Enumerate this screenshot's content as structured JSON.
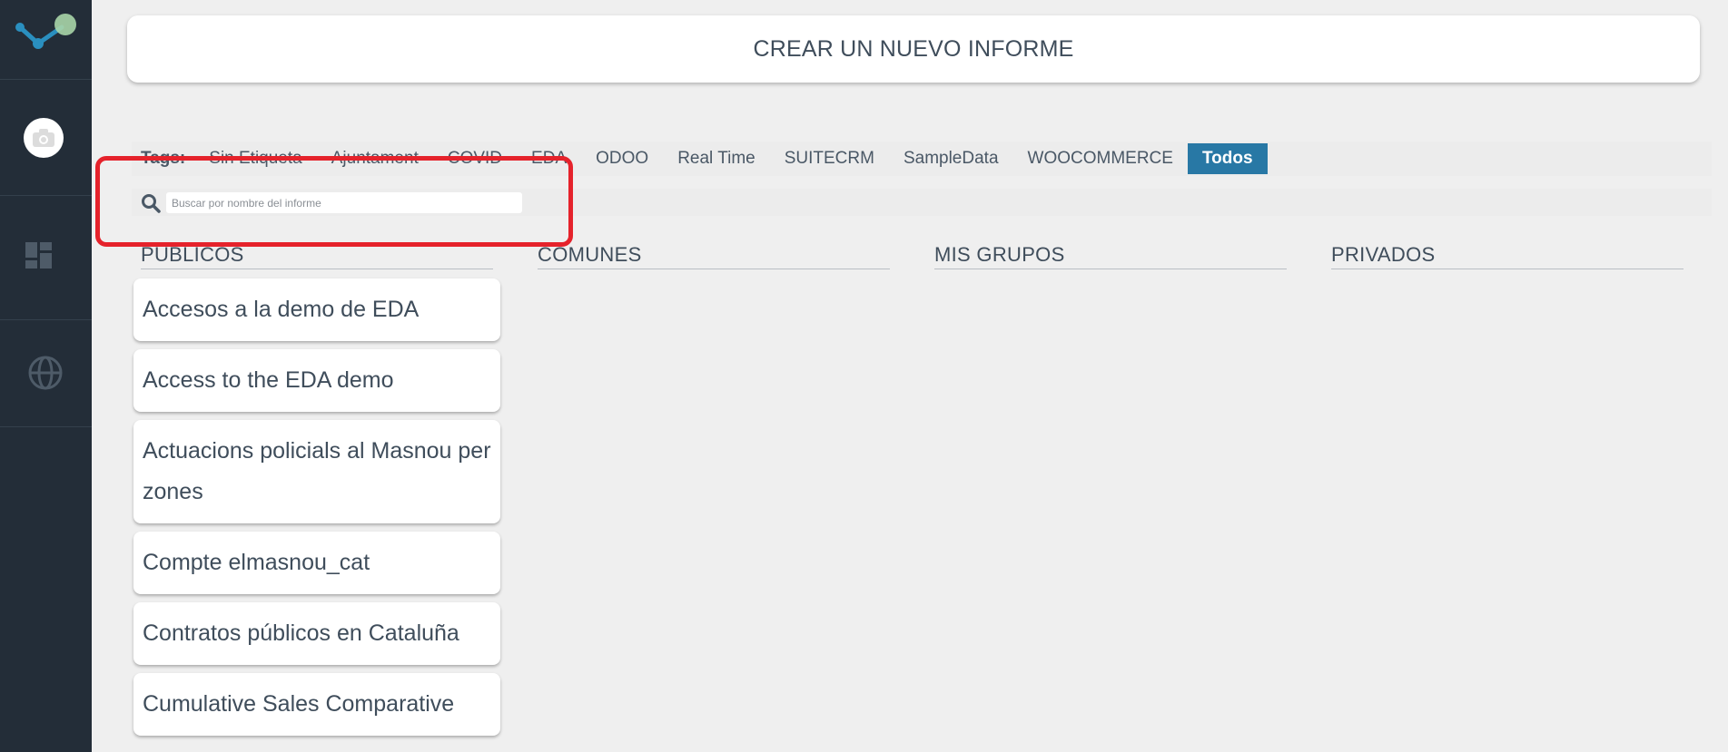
{
  "main": {
    "create_button_label": "CREAR UN NUEVO INFORME",
    "tags": {
      "label": "Tags:",
      "items": [
        {
          "label": "Sin Etiqueta"
        },
        {
          "label": "Ajuntament"
        },
        {
          "label": "COVID"
        },
        {
          "label": "EDA"
        },
        {
          "label": "ODOO"
        },
        {
          "label": "Real Time"
        },
        {
          "label": "SUITECRM"
        },
        {
          "label": "SampleData"
        },
        {
          "label": "WOOCOMMERCE"
        },
        {
          "label": "Todos"
        }
      ],
      "active": "Todos"
    },
    "search": {
      "placeholder": "Buscar por nombre del informe",
      "value": ""
    },
    "columns": [
      {
        "title": "PUBLICOS"
      },
      {
        "title": "COMUNES"
      },
      {
        "title": "MIS GRUPOS"
      },
      {
        "title": "PRIVADOS"
      }
    ],
    "public_reports": [
      "Accesos a la demo de EDA",
      "Access to the EDA demo",
      "Actuacions policials al Masnou per zones",
      "Compte elmasnou_cat",
      "Contratos públicos en Cataluña",
      "Cumulative Sales Comparative"
    ]
  },
  "colors": {
    "sidebar_bg": "#232d38",
    "accent": "#2878a5",
    "highlight": "#e5222b"
  },
  "icons": {
    "logo": "graph-logo-icon",
    "avatar": "camera-icon",
    "dashboard": "dashboard-icon",
    "globe": "globe-icon",
    "search": "search-icon"
  }
}
